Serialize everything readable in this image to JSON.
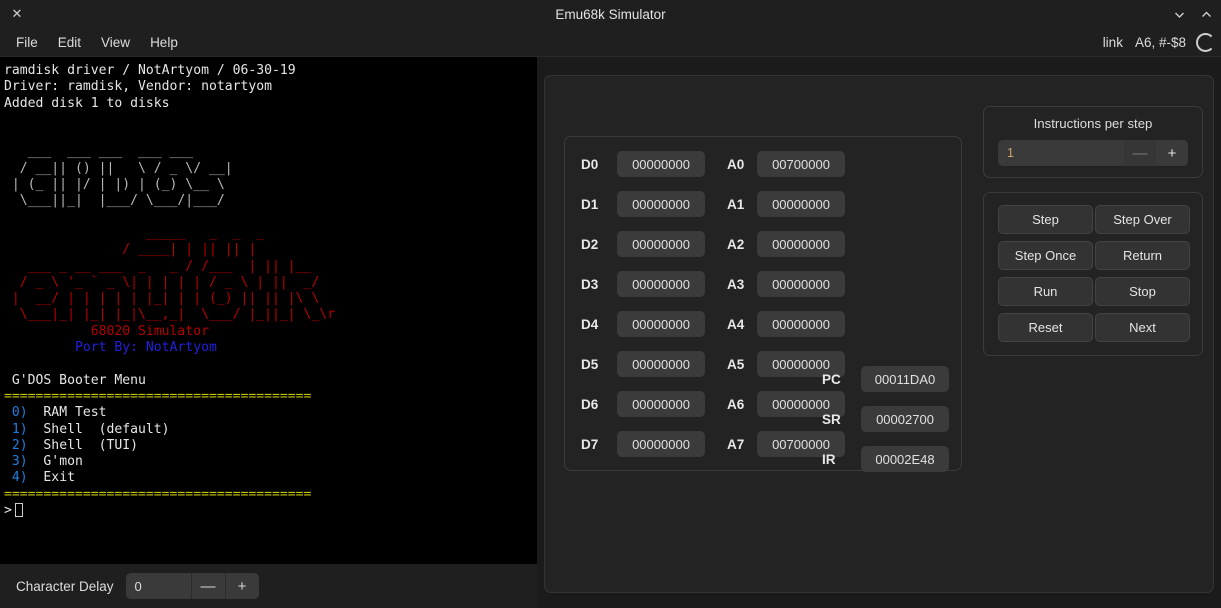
{
  "window": {
    "title": "Emu68k Simulator",
    "close_icon": "close-icon",
    "chevron_down_icon": "chevron-down-icon",
    "chevron_up_icon": "chevron-up-icon"
  },
  "menubar": {
    "items": [
      {
        "label": "File"
      },
      {
        "label": "Edit"
      },
      {
        "label": "View"
      },
      {
        "label": "Help"
      }
    ],
    "status_left": "link",
    "status_right": "A6, #-$8",
    "spinner_icon": "spinner-icon"
  },
  "terminal": {
    "lines": [
      {
        "text": "ramdisk driver / NotArtyom / 06-30-19",
        "color": "white"
      },
      {
        "text": "Driver: ramdisk, Vendor: notartyom",
        "color": "white"
      },
      {
        "text": "Added disk 1 to disks",
        "color": "white"
      },
      {
        "text": "",
        "color": "white"
      },
      {
        "text": "",
        "color": "white"
      },
      {
        "text": "   ___  ___ ___  ___ ___ ",
        "color": "grey"
      },
      {
        "text": "  / __|| () ||   \\ / _ \\/ __|",
        "color": "grey"
      },
      {
        "text": " | (_ || |/ | |) | (_) \\__ \\",
        "color": "grey"
      },
      {
        "text": "  \\___||_|  |___/ \\___/|___/",
        "color": "grey"
      },
      {
        "text": "",
        "color": "white"
      },
      {
        "text": "                  _____   _  _  _ ",
        "color": "red"
      },
      {
        "text": "               / ____| | || || |",
        "color": "red"
      },
      {
        "text": "   ___ _ __ ___  _   _ / /___  | || |__  ",
        "color": "red"
      },
      {
        "text": "  / _ \\ '_ ` _ \\| | | | | / _ \\ | ||  _/ ",
        "color": "red"
      },
      {
        "text": " |  __/ | | | | | |_| | | (_) || || |\\ \\ ",
        "color": "red"
      },
      {
        "text": "  \\___|_| |_| |_|\\__,_|  \\___/ |_||_| \\_\\r",
        "color": "red"
      },
      {
        "text": "           68020 Simulator",
        "color": "red"
      },
      {
        "text": "         Port By: NotArtyom",
        "color": "blue"
      },
      {
        "text": "",
        "color": "white"
      },
      {
        "text": " G'DOS Booter Menu",
        "color": "white"
      },
      {
        "text": "=======================================",
        "color": "yellow"
      }
    ],
    "menu_entries": [
      {
        "num": " 0)",
        "label": "  RAM Test"
      },
      {
        "num": " 1)",
        "label": "  Shell  (default)"
      },
      {
        "num": " 2)",
        "label": "  Shell  (TUI)"
      },
      {
        "num": " 3)",
        "label": "  G'mon"
      },
      {
        "num": " 4)",
        "label": "  Exit"
      }
    ],
    "separator": "=======================================",
    "prompt": ">",
    "colors": {
      "background": "#000000",
      "white": "#e6e6e6",
      "grey": "#b9b9b9",
      "red": "#b60000",
      "blue": "#2020dd",
      "yellow": "#c6c600",
      "menu_number": "#1f7fe0"
    }
  },
  "character_delay": {
    "label": "Character Delay",
    "value": "0",
    "minus_label": "—",
    "plus_label": "+"
  },
  "registers": {
    "data": [
      {
        "label": "D0",
        "value": "00000000"
      },
      {
        "label": "D1",
        "value": "00000000"
      },
      {
        "label": "D2",
        "value": "00000000"
      },
      {
        "label": "D3",
        "value": "00000000"
      },
      {
        "label": "D4",
        "value": "00000000"
      },
      {
        "label": "D5",
        "value": "00000000"
      },
      {
        "label": "D6",
        "value": "00000000"
      },
      {
        "label": "D7",
        "value": "00000000"
      }
    ],
    "address": [
      {
        "label": "A0",
        "value": "00700000"
      },
      {
        "label": "A1",
        "value": "00000000"
      },
      {
        "label": "A2",
        "value": "00000000"
      },
      {
        "label": "A3",
        "value": "00000000"
      },
      {
        "label": "A4",
        "value": "00000000"
      },
      {
        "label": "A5",
        "value": "00000000"
      },
      {
        "label": "A6",
        "value": "00000000"
      },
      {
        "label": "A7",
        "value": "00700000"
      }
    ],
    "special": [
      {
        "label": "PC",
        "value": "00011DA0"
      },
      {
        "label": "SR",
        "value": "00002700"
      },
      {
        "label": "IR",
        "value": "00002E48"
      }
    ]
  },
  "instructions_per_step": {
    "title": "Instructions per step",
    "value": "1",
    "minus_label": "—",
    "plus_label": "+"
  },
  "controls": {
    "buttons": [
      {
        "label": "Step"
      },
      {
        "label": "Step Over"
      },
      {
        "label": "Step Once"
      },
      {
        "label": "Return"
      },
      {
        "label": "Run"
      },
      {
        "label": "Stop"
      },
      {
        "label": "Reset"
      },
      {
        "label": "Next"
      }
    ]
  },
  "accent_color": "#b4174e"
}
